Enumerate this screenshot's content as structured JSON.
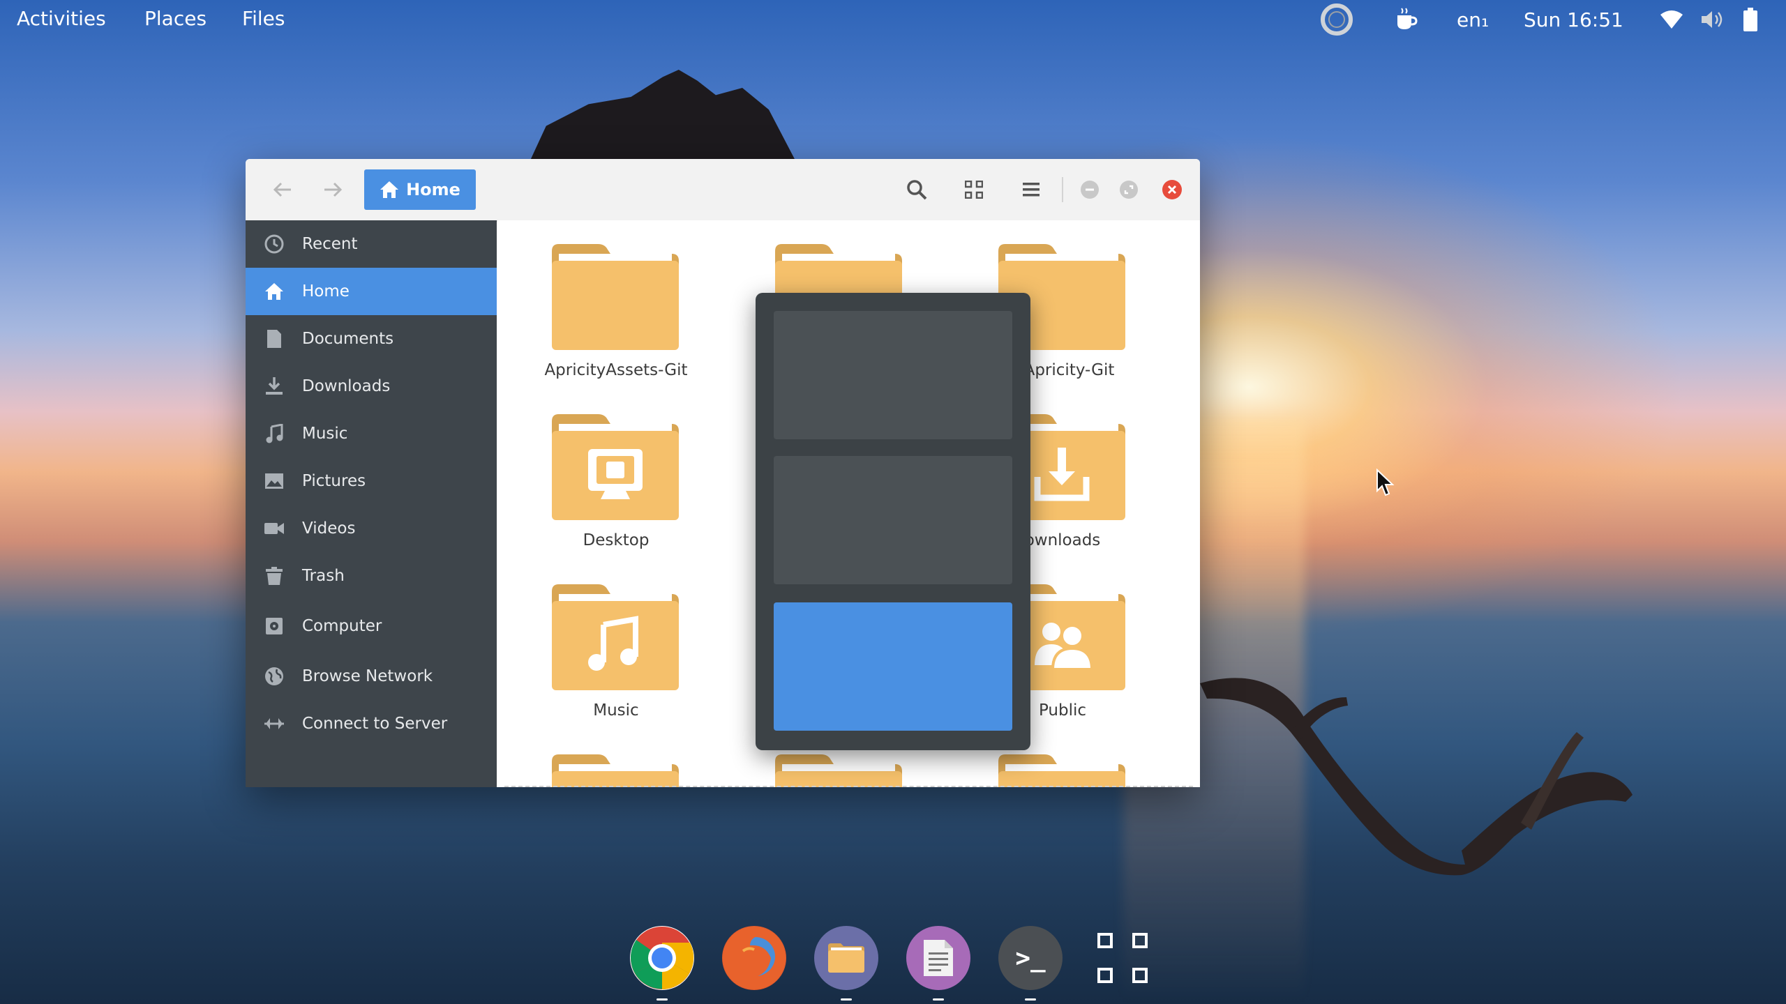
{
  "topbar": {
    "activities": "Activities",
    "places": "Places",
    "files": "Files",
    "keyboard_layout": "en₁",
    "clock": "Sun 16:51"
  },
  "window": {
    "breadcrumb_home": "Home",
    "sidebar": {
      "items": [
        {
          "label": "Recent",
          "icon": "clock-icon"
        },
        {
          "label": "Home",
          "icon": "home-icon",
          "active": true
        },
        {
          "label": "Documents",
          "icon": "document-icon"
        },
        {
          "label": "Downloads",
          "icon": "download-icon"
        },
        {
          "label": "Music",
          "icon": "music-note-icon"
        },
        {
          "label": "Pictures",
          "icon": "picture-icon"
        },
        {
          "label": "Videos",
          "icon": "video-camera-icon"
        },
        {
          "label": "Trash",
          "icon": "trash-icon"
        },
        {
          "label": "Computer",
          "icon": "disk-icon"
        },
        {
          "label": "Browse Network",
          "icon": "globe-icon"
        },
        {
          "label": "Connect to Server",
          "icon": "server-connect-icon"
        }
      ]
    },
    "folders": [
      {
        "label": "ApricityAssets-Git",
        "emblem": "none"
      },
      {
        "label": "",
        "emblem": "none"
      },
      {
        "label": "icApricity-Git",
        "emblem": "none"
      },
      {
        "label": "Desktop",
        "emblem": "desktop"
      },
      {
        "label": "ownloads",
        "emblem": "download"
      },
      {
        "label": "Music",
        "emblem": "music"
      },
      {
        "label": "Public",
        "emblem": "people"
      }
    ]
  },
  "colors": {
    "accent": "#4a90e2",
    "sidebar_bg": "#3e454b",
    "folder": "#f5c06b",
    "close": "#e74c3c",
    "popup_bg": "#3c4246"
  },
  "dock": {
    "apps": [
      "chrome-icon",
      "firefox-icon",
      "files-icon",
      "text-editor-icon",
      "terminal-icon",
      "app-grid-icon"
    ],
    "terminal_glyph": ">_"
  }
}
